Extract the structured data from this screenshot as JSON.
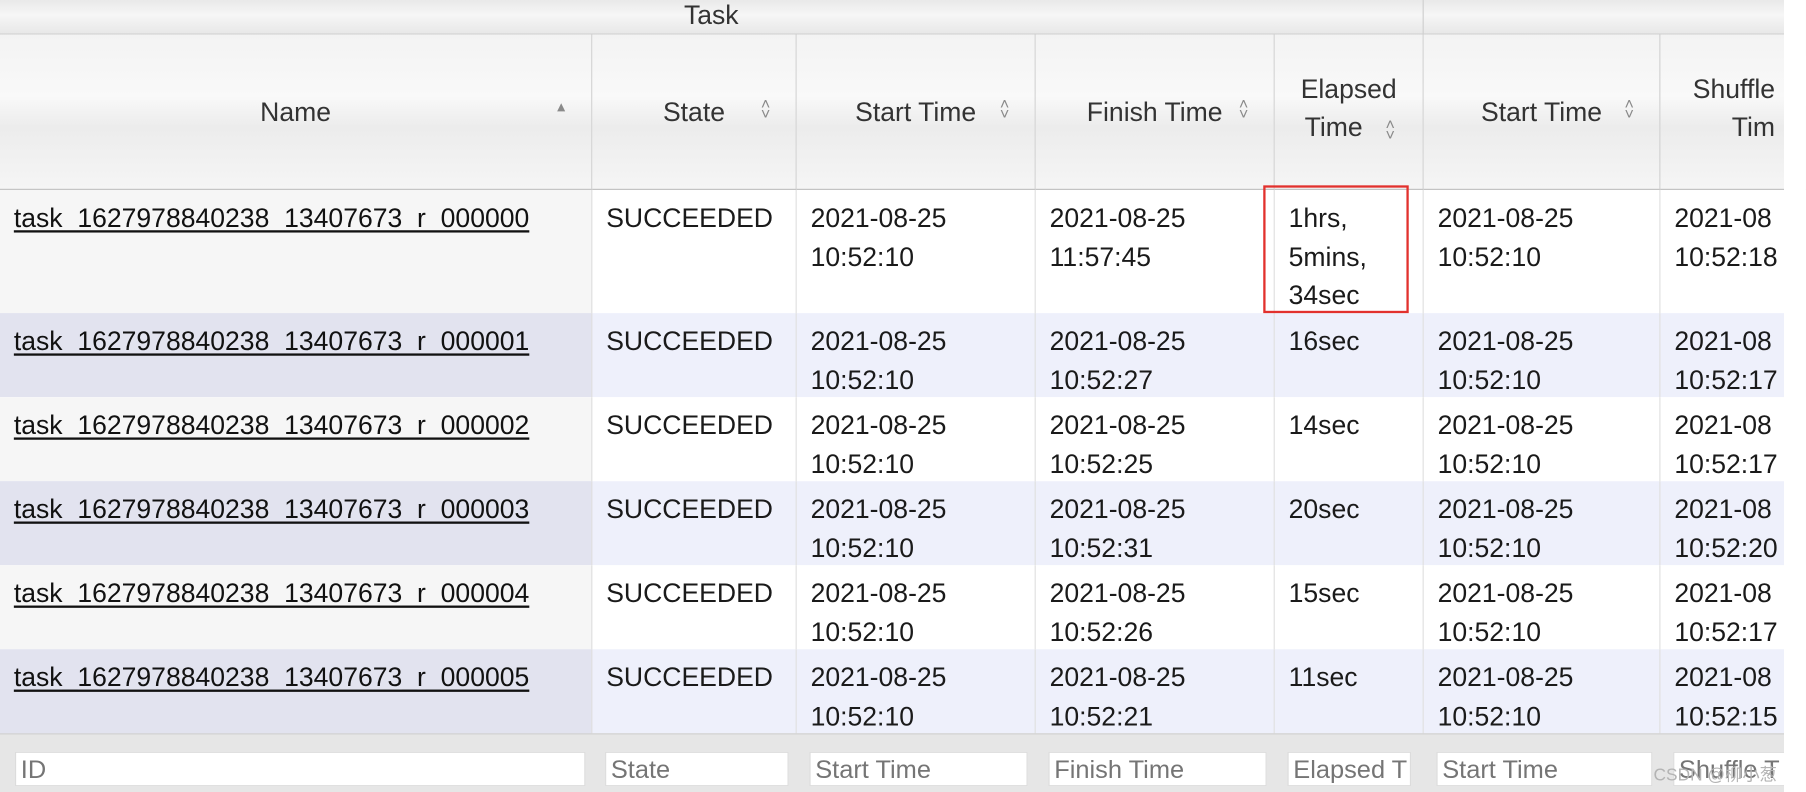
{
  "group_header": {
    "task_label": "Task"
  },
  "columns": [
    {
      "label": "Name",
      "sort": "asc"
    },
    {
      "label": "State",
      "sort": "both"
    },
    {
      "label": "Start Time",
      "sort": "both"
    },
    {
      "label": "Finish Time",
      "sort": "both"
    },
    {
      "label_line1": "Elapsed",
      "label_line2": "Time",
      "sort": "both"
    },
    {
      "label": "Start Time",
      "sort": "both"
    },
    {
      "label_line1": "Shuffle",
      "label_line2": "Tim"
    }
  ],
  "rows": [
    {
      "name": "task_1627978840238_13407673_r_000000",
      "state": "SUCCEEDED",
      "start1": "2021-08-25",
      "start2": "10:52:10",
      "finish1": "2021-08-25",
      "finish2": "11:57:45",
      "elapsed1": "1hrs,",
      "elapsed2": "5mins,",
      "elapsed3": "34sec",
      "attempt_start1": "2021-08-25",
      "attempt_start2": "10:52:10",
      "shuffle1": "2021-08",
      "shuffle2": "10:52:18"
    },
    {
      "name": "task_1627978840238_13407673_r_000001",
      "state": "SUCCEEDED",
      "start1": "2021-08-25",
      "start2": "10:52:10",
      "finish1": "2021-08-25",
      "finish2": "10:52:27",
      "elapsed1": "16sec",
      "attempt_start1": "2021-08-25",
      "attempt_start2": "10:52:10",
      "shuffle1": "2021-08",
      "shuffle2": "10:52:17"
    },
    {
      "name": "task_1627978840238_13407673_r_000002",
      "state": "SUCCEEDED",
      "start1": "2021-08-25",
      "start2": "10:52:10",
      "finish1": "2021-08-25",
      "finish2": "10:52:25",
      "elapsed1": "14sec",
      "attempt_start1": "2021-08-25",
      "attempt_start2": "10:52:10",
      "shuffle1": "2021-08",
      "shuffle2": "10:52:17"
    },
    {
      "name": "task_1627978840238_13407673_r_000003",
      "state": "SUCCEEDED",
      "start1": "2021-08-25",
      "start2": "10:52:10",
      "finish1": "2021-08-25",
      "finish2": "10:52:31",
      "elapsed1": "20sec",
      "attempt_start1": "2021-08-25",
      "attempt_start2": "10:52:10",
      "shuffle1": "2021-08",
      "shuffle2": "10:52:20"
    },
    {
      "name": "task_1627978840238_13407673_r_000004",
      "state": "SUCCEEDED",
      "start1": "2021-08-25",
      "start2": "10:52:10",
      "finish1": "2021-08-25",
      "finish2": "10:52:26",
      "elapsed1": "15sec",
      "attempt_start1": "2021-08-25",
      "attempt_start2": "10:52:10",
      "shuffle1": "2021-08",
      "shuffle2": "10:52:17"
    },
    {
      "name": "task_1627978840238_13407673_r_000005",
      "state": "SUCCEEDED",
      "start1": "2021-08-25",
      "start2": "10:52:10",
      "finish1": "2021-08-25",
      "finish2": "10:52:21",
      "elapsed1": "11sec",
      "attempt_start1": "2021-08-25",
      "attempt_start2": "10:52:10",
      "shuffle1": "2021-08",
      "shuffle2": "10:52:15"
    }
  ],
  "filters": {
    "id_placeholder": "ID",
    "state_placeholder": "State",
    "start_placeholder": "Start Time",
    "finish_placeholder": "Finish Time",
    "elapsed_placeholder": "Elapsed T",
    "attempt_start_placeholder": "Start Time",
    "shuffle_placeholder": "Shuffle T"
  },
  "watermark": "CSDN @柳小葱",
  "colors": {
    "highlight": "#e2312d",
    "row_even": "#eef0fb",
    "name_even": "#e2e3ef",
    "name_odd": "#f6f6f6"
  }
}
